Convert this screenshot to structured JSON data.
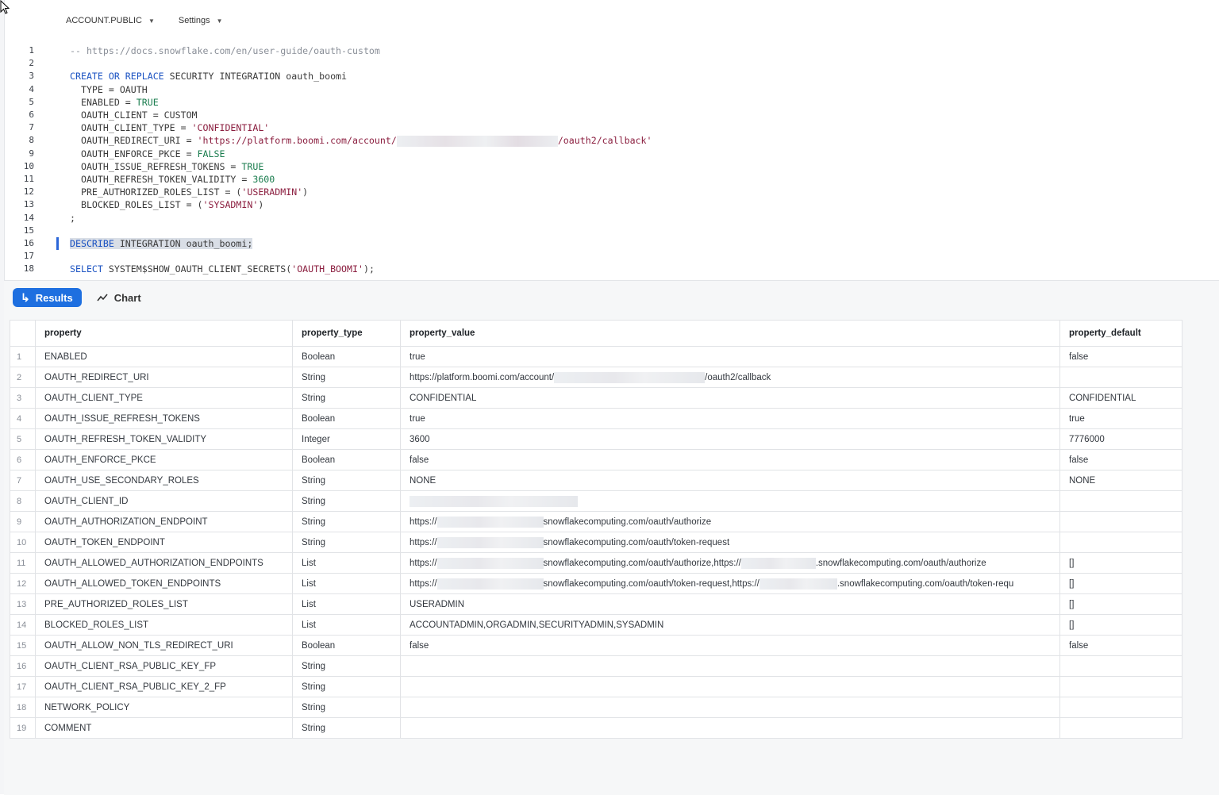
{
  "topbar": {
    "context": "ACCOUNT.PUBLIC",
    "settings": "Settings"
  },
  "editor": {
    "lines": [
      {
        "n": "1",
        "parts": [
          {
            "t": "-- https://docs.snowflake.com/en/user-guide/oauth-custom",
            "c": "cmt"
          }
        ]
      },
      {
        "n": "2",
        "parts": []
      },
      {
        "n": "3",
        "parts": [
          {
            "t": "CREATE OR REPLACE",
            "c": "kw"
          },
          {
            "t": " SECURITY INTEGRATION oauth_boomi",
            "c": ""
          }
        ]
      },
      {
        "n": "4",
        "parts": [
          {
            "t": "  TYPE = OAUTH",
            "c": ""
          }
        ]
      },
      {
        "n": "5",
        "parts": [
          {
            "t": "  ENABLED = ",
            "c": ""
          },
          {
            "t": "TRUE",
            "c": "lit"
          }
        ]
      },
      {
        "n": "6",
        "parts": [
          {
            "t": "  OAUTH_CLIENT = CUSTOM",
            "c": ""
          }
        ]
      },
      {
        "n": "7",
        "parts": [
          {
            "t": "  OAUTH_CLIENT_TYPE = ",
            "c": ""
          },
          {
            "t": "'CONFIDENTIAL'",
            "c": "str"
          }
        ]
      },
      {
        "n": "8",
        "parts": [
          {
            "t": "  OAUTH_REDIRECT_URI = ",
            "c": ""
          },
          {
            "t": "'https://platform.boomi.com/account/",
            "c": "str"
          },
          {
            "t": "",
            "c": "redact"
          },
          {
            "t": "/oauth2/callback'",
            "c": "str"
          }
        ]
      },
      {
        "n": "9",
        "parts": [
          {
            "t": "  OAUTH_ENFORCE_PKCE = ",
            "c": ""
          },
          {
            "t": "FALSE",
            "c": "lit"
          }
        ]
      },
      {
        "n": "10",
        "parts": [
          {
            "t": "  OAUTH_ISSUE_REFRESH_TOKENS = ",
            "c": ""
          },
          {
            "t": "TRUE",
            "c": "lit"
          }
        ]
      },
      {
        "n": "11",
        "parts": [
          {
            "t": "  OAUTH_REFRESH_TOKEN_VALIDITY = ",
            "c": ""
          },
          {
            "t": "3600",
            "c": "num"
          }
        ]
      },
      {
        "n": "12",
        "parts": [
          {
            "t": "  PRE_AUTHORIZED_ROLES_LIST = (",
            "c": ""
          },
          {
            "t": "'USERADMIN'",
            "c": "str"
          },
          {
            "t": ")",
            "c": ""
          }
        ]
      },
      {
        "n": "13",
        "parts": [
          {
            "t": "  BLOCKED_ROLES_LIST = (",
            "c": ""
          },
          {
            "t": "'SYSADMIN'",
            "c": "str"
          },
          {
            "t": ")",
            "c": ""
          }
        ]
      },
      {
        "n": "14",
        "parts": [
          {
            "t": ";",
            "c": ""
          }
        ]
      },
      {
        "n": "15",
        "parts": []
      },
      {
        "n": "16",
        "parts": [
          {
            "t": "DESCRIBE",
            "c": "kw sel"
          },
          {
            "t": " INTEGRATION oauth_boomi;",
            "c": "sel"
          }
        ]
      },
      {
        "n": "17",
        "parts": []
      },
      {
        "n": "18",
        "parts": [
          {
            "t": "SELECT",
            "c": "kw"
          },
          {
            "t": " SYSTEM$SHOW_OAUTH_CLIENT_SECRETS(",
            "c": ""
          },
          {
            "t": "'OAUTH_BOOMI'",
            "c": "str"
          },
          {
            "t": ");",
            "c": ""
          }
        ]
      }
    ]
  },
  "tabs": {
    "results": "Results",
    "chart": "Chart"
  },
  "table": {
    "columns": [
      "property",
      "property_type",
      "property_value",
      "property_default"
    ],
    "rows": [
      {
        "n": "1",
        "property": "ENABLED",
        "type": "Boolean",
        "value": "true",
        "default": "false"
      },
      {
        "n": "2",
        "property": "OAUTH_REDIRECT_URI",
        "type": "String",
        "value_parts": [
          "https://platform.boomi.com/account/",
          "",
          "/oauth2/callback"
        ],
        "default": ""
      },
      {
        "n": "3",
        "property": "OAUTH_CLIENT_TYPE",
        "type": "String",
        "value": "CONFIDENTIAL",
        "default": "CONFIDENTIAL"
      },
      {
        "n": "4",
        "property": "OAUTH_ISSUE_REFRESH_TOKENS",
        "type": "Boolean",
        "value": "true",
        "default": "true"
      },
      {
        "n": "5",
        "property": "OAUTH_REFRESH_TOKEN_VALIDITY",
        "type": "Integer",
        "value": "3600",
        "default": "7776000"
      },
      {
        "n": "6",
        "property": "OAUTH_ENFORCE_PKCE",
        "type": "Boolean",
        "value": "false",
        "default": "false"
      },
      {
        "n": "7",
        "property": "OAUTH_USE_SECONDARY_ROLES",
        "type": "String",
        "value": "NONE",
        "default": "NONE"
      },
      {
        "n": "8",
        "property": "OAUTH_CLIENT_ID",
        "type": "String",
        "value_parts": [
          ""
        ],
        "default": ""
      },
      {
        "n": "9",
        "property": "OAUTH_AUTHORIZATION_ENDPOINT",
        "type": "String",
        "value_parts": [
          "https://",
          "",
          "snowflakecomputing.com/oauth/authorize"
        ],
        "default": ""
      },
      {
        "n": "10",
        "property": "OAUTH_TOKEN_ENDPOINT",
        "type": "String",
        "value_parts": [
          "https://",
          "",
          "snowflakecomputing.com/oauth/token-request"
        ],
        "default": ""
      },
      {
        "n": "11",
        "property": "OAUTH_ALLOWED_AUTHORIZATION_ENDPOINTS",
        "type": "List",
        "value_parts": [
          "https://",
          "",
          "snowflakecomputing.com/oauth/authorize,https://",
          "",
          ".snowflakecomputing.com/oauth/authorize"
        ],
        "default": "[]"
      },
      {
        "n": "12",
        "property": "OAUTH_ALLOWED_TOKEN_ENDPOINTS",
        "type": "List",
        "value_parts": [
          "https://",
          "",
          "snowflakecomputing.com/oauth/token-request,https://",
          "",
          ".snowflakecomputing.com/oauth/token-requ"
        ],
        "default": "[]"
      },
      {
        "n": "13",
        "property": "PRE_AUTHORIZED_ROLES_LIST",
        "type": "List",
        "value": "USERADMIN",
        "default": "[]"
      },
      {
        "n": "14",
        "property": "BLOCKED_ROLES_LIST",
        "type": "List",
        "value": "ACCOUNTADMIN,ORGADMIN,SECURITYADMIN,SYSADMIN",
        "default": "[]"
      },
      {
        "n": "15",
        "property": "OAUTH_ALLOW_NON_TLS_REDIRECT_URI",
        "type": "Boolean",
        "value": "false",
        "default": "false"
      },
      {
        "n": "16",
        "property": "OAUTH_CLIENT_RSA_PUBLIC_KEY_FP",
        "type": "String",
        "value": "",
        "default": ""
      },
      {
        "n": "17",
        "property": "OAUTH_CLIENT_RSA_PUBLIC_KEY_2_FP",
        "type": "String",
        "value": "",
        "default": ""
      },
      {
        "n": "18",
        "property": "NETWORK_POLICY",
        "type": "String",
        "value": "",
        "default": ""
      },
      {
        "n": "19",
        "property": "COMMENT",
        "type": "String",
        "value": "",
        "default": ""
      }
    ]
  },
  "colors": {
    "accent": "#1e6fe0",
    "keyword": "#1a52c2",
    "string": "#8b1e3f",
    "literal": "#1b7d4f"
  },
  "icons": {
    "results": "return-arrow-icon",
    "chart": "line-chart-icon"
  }
}
